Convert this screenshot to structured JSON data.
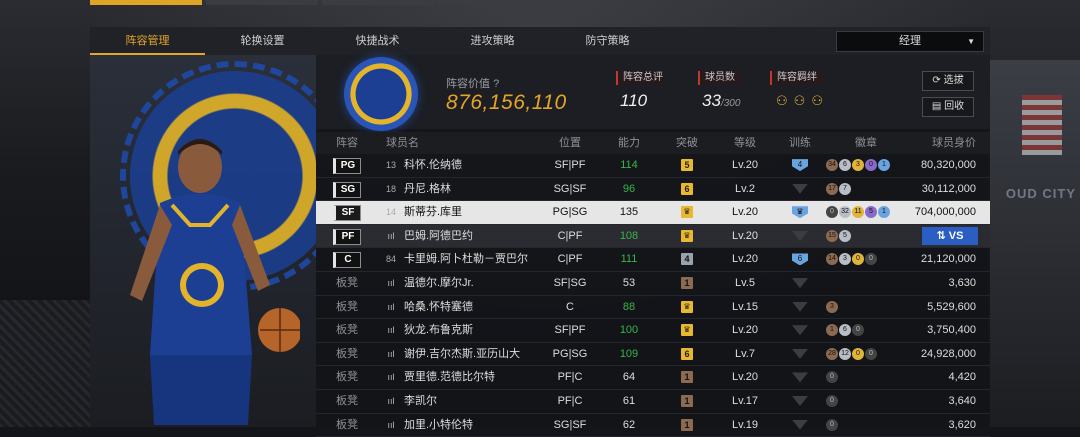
{
  "tabs": [
    "阵容管理",
    "轮换设置",
    "快捷战术",
    "进攻策略",
    "防守策略"
  ],
  "dropdown": {
    "value": "经理"
  },
  "team": {
    "value_label": "阵容价值",
    "value": "876,156,110",
    "rating_label": "阵容总评",
    "rating": "110",
    "count_label": "球员数",
    "count": "33",
    "count_max": "/300",
    "chem_label": "阵容羁绊"
  },
  "buttons": {
    "select": "选拔",
    "recycle": "回收"
  },
  "headers": [
    "阵容",
    "球员名",
    "位置",
    "能力",
    "突破",
    "等级",
    "训练",
    "徽章",
    "球员身价"
  ],
  "vs_label": "VS",
  "rows": [
    {
      "pos": "PG",
      "num": "13",
      "name": "科怀.伦纳德",
      "loc": "SF|PF",
      "rating": "114",
      "brk": "5",
      "brk_type": "gold",
      "lvl": "Lv.20",
      "trn": "4",
      "badges": [
        "34b",
        "6s",
        "3g",
        "0p",
        "1d"
      ],
      "salary": "80,320,000"
    },
    {
      "pos": "SG",
      "num": "18",
      "name": "丹尼.格林",
      "loc": "SG|SF",
      "rating": "96",
      "brk": "6",
      "brk_type": "gold",
      "lvl": "Lv.2",
      "trn": "",
      "badges": [
        "17b",
        "7s"
      ],
      "salary": "30,112,000"
    },
    {
      "pos": "SF",
      "num": "14",
      "name": "斯蒂芬.库里",
      "loc": "PG|SG",
      "rating": "135",
      "brk": "♛",
      "brk_type": "crown",
      "lvl": "Lv.20",
      "trn": "♛",
      "badges": [
        "0x",
        "32s",
        "11g",
        "5p",
        "1d"
      ],
      "salary": "704,000,000"
    },
    {
      "pos": "PF",
      "num": "",
      "name": "巴姆.阿德巴约",
      "loc": "C|PF",
      "rating": "108",
      "brk": "♛",
      "brk_type": "crown",
      "lvl": "Lv.20",
      "trn": "",
      "badges": [
        "15b",
        "5s"
      ],
      "salary": ""
    },
    {
      "pos": "C",
      "num": "84",
      "name": "卡里姆.阿卜杜勒－贾巴尔",
      "loc": "C|PF",
      "rating": "111",
      "brk": "4",
      "brk_type": "silver",
      "lvl": "Lv.20",
      "trn": "6",
      "badges": [
        "14b",
        "3s",
        "0g",
        "0x"
      ],
      "salary": "21,120,000"
    },
    {
      "pos": "板凳",
      "num": "",
      "name": "温德尔.摩尔Jr.",
      "loc": "SF|SG",
      "rating": "53",
      "brk": "1",
      "brk_type": "bronze",
      "lvl": "Lv.5",
      "trn": "",
      "badges": [],
      "salary": "3,630"
    },
    {
      "pos": "板凳",
      "num": "",
      "name": "哈桑.怀特塞德",
      "loc": "C",
      "rating": "88",
      "brk": "♛",
      "brk_type": "crown",
      "lvl": "Lv.15",
      "trn": "",
      "badges": [
        "3b"
      ],
      "salary": "5,529,600"
    },
    {
      "pos": "板凳",
      "num": "",
      "name": "狄龙.布鲁克斯",
      "loc": "SF|PF",
      "rating": "100",
      "brk": "♛",
      "brk_type": "crown",
      "lvl": "Lv.20",
      "trn": "",
      "badges": [
        "1b",
        "6s",
        "0x"
      ],
      "salary": "3,750,400"
    },
    {
      "pos": "板凳",
      "num": "",
      "name": "谢伊.吉尔杰斯.亚历山大",
      "loc": "PG|SG",
      "rating": "109",
      "brk": "6",
      "brk_type": "gold",
      "lvl": "Lv.7",
      "trn": "",
      "badges": [
        "28b",
        "12s",
        "0g",
        "0x"
      ],
      "salary": "24,928,000"
    },
    {
      "pos": "板凳",
      "num": "",
      "name": "贾里德.范德比尔特",
      "loc": "PF|C",
      "rating": "64",
      "brk": "1",
      "brk_type": "bronze",
      "lvl": "Lv.20",
      "trn": "",
      "badges": [
        "0x"
      ],
      "salary": "4,420"
    },
    {
      "pos": "板凳",
      "num": "",
      "name": "李凯尔",
      "loc": "PF|C",
      "rating": "61",
      "brk": "1",
      "brk_type": "bronze",
      "lvl": "Lv.17",
      "trn": "",
      "badges": [
        "0x"
      ],
      "salary": "3,640"
    },
    {
      "pos": "板凳",
      "num": "",
      "name": "加里.小特伦特",
      "loc": "SG|SF",
      "rating": "62",
      "brk": "1",
      "brk_type": "bronze",
      "lvl": "Lv.19",
      "trn": "",
      "badges": [
        "0x"
      ],
      "salary": "3,620"
    }
  ],
  "background_text": "OUD CITY"
}
